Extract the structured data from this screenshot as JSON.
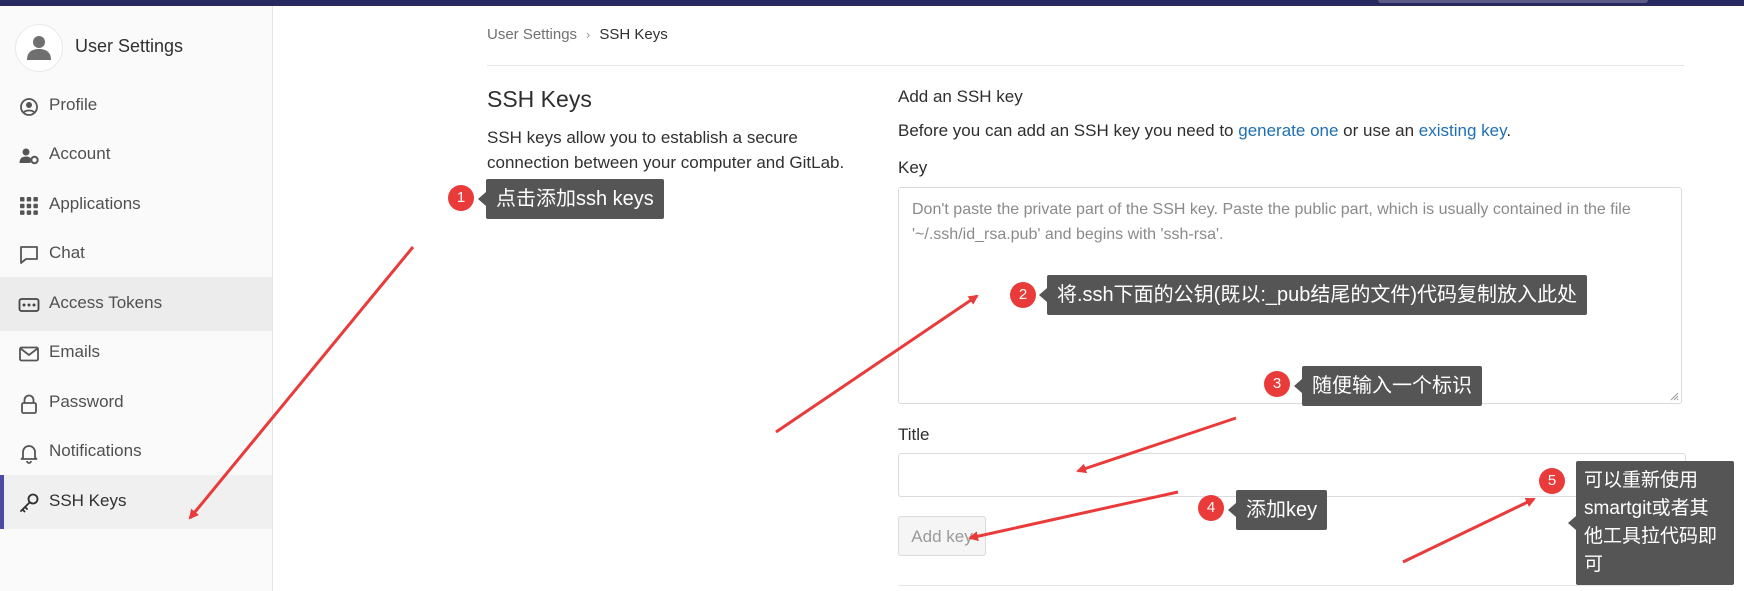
{
  "app": {
    "title": "User Settings"
  },
  "sidebar": {
    "items": [
      {
        "label": "Profile",
        "icon": "profile-icon"
      },
      {
        "label": "Account",
        "icon": "account-icon"
      },
      {
        "label": "Applications",
        "icon": "applications-icon"
      },
      {
        "label": "Chat",
        "icon": "chat-icon"
      },
      {
        "label": "Access Tokens",
        "icon": "token-icon"
      },
      {
        "label": "Emails",
        "icon": "email-icon"
      },
      {
        "label": "Password",
        "icon": "lock-icon"
      },
      {
        "label": "Notifications",
        "icon": "bell-icon"
      },
      {
        "label": "SSH Keys",
        "icon": "key-icon"
      }
    ]
  },
  "breadcrumb": {
    "parent": "User Settings",
    "separator": "›",
    "current": "SSH Keys"
  },
  "section": {
    "title": "SSH Keys",
    "description": "SSH keys allow you to establish a secure connection between your computer and GitLab."
  },
  "form": {
    "title": "Add an SSH key",
    "intro_prefix": "Before you can add an SSH key you need to ",
    "intro_link1": "generate one",
    "intro_middle": " or use an ",
    "intro_link2": "existing key",
    "intro_suffix": ".",
    "key_label": "Key",
    "key_placeholder": "Don't paste the private part of the SSH key. Paste the public part, which is usually contained in the file '~/.ssh/id_rsa.pub' and begins with 'ssh-rsa'.",
    "title_label": "Title",
    "title_value": "",
    "add_button": "Add key"
  },
  "annotations": [
    {
      "number": "1",
      "text": "点击添加ssh keys"
    },
    {
      "number": "2",
      "text": "将.ssh下面的公钥(既以:_pub结尾的文件)代码复制放入此处"
    },
    {
      "number": "3",
      "text": "随便输入一个标识"
    },
    {
      "number": "4",
      "text": "添加key"
    },
    {
      "number": "5",
      "text": "可以重新使用smartgit或者其他工具拉代码即可"
    }
  ],
  "colors": {
    "topbar": "#292961",
    "active_accent": "#4b4ba3",
    "link": "#1f6fb5",
    "annotation_badge": "#ea3b3b",
    "annotation_box": "#555555",
    "arrow": "#ea3b3b"
  }
}
